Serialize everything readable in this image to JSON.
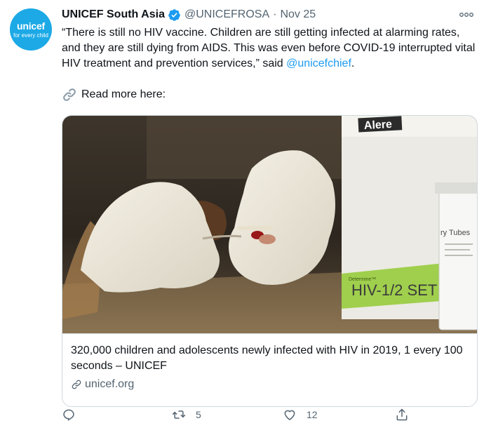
{
  "author": {
    "name": "UNICEF South Asia",
    "handle": "@UNICEFROSA",
    "separator": "·",
    "time": "Nov 25",
    "avatar_brand": "unicef",
    "avatar_tagline": "for every child",
    "avatar_color": "#1ca9e6"
  },
  "tweet": {
    "text_before_mention": "“There is still no HIV vaccine. Children are still getting infected at alarming rates, and they are still dying from AIDS. This was even before COVID-19 interrupted vital HIV treatment and prevention services,” said ",
    "mention": "@unicefchief",
    "text_after_mention": ".",
    "read_more": "Read more here:"
  },
  "card": {
    "image_text_brand": "Alere",
    "image_text_tubes": "ry Tubes",
    "image_text_determine": "Determine™",
    "image_text_set": "HIV-1/2 SET",
    "title": "320,000 children and adolescents newly infected with HIV in 2019, 1 every 100 seconds – UNICEF",
    "domain": "unicef.org"
  },
  "actions": {
    "reply_count": "",
    "retweet_count": "5",
    "like_count": "12",
    "share_count": ""
  },
  "colors": {
    "accent": "#1d9bf0",
    "secondary_text": "#536471",
    "border": "#cfd9de"
  },
  "icons": [
    "verified-badge-icon",
    "more-options-icon",
    "link-icon",
    "chain-link-icon",
    "reply-icon",
    "retweet-icon",
    "like-icon",
    "share-icon"
  ]
}
